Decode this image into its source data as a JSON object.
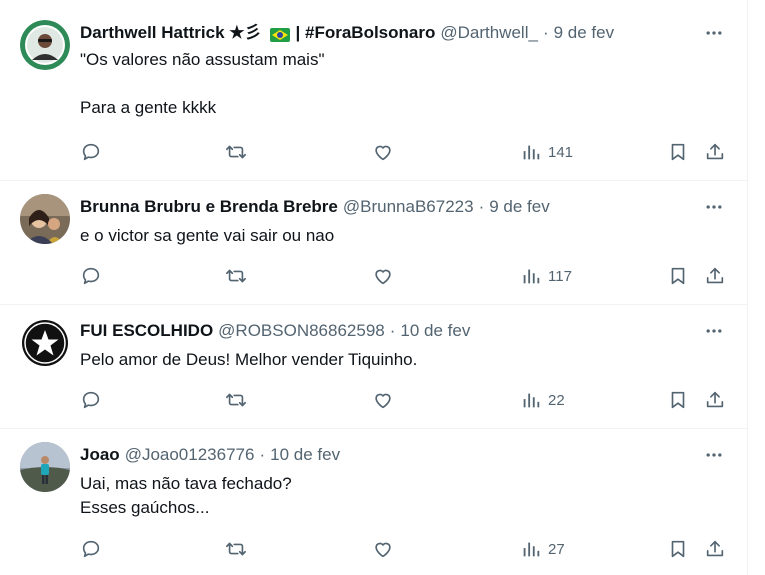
{
  "colors": {
    "text_primary": "#0f1419",
    "text_secondary": "#536471",
    "divider": "#eff3f4"
  },
  "tweets": [
    {
      "author_name": "Darthwell Hattrick ★彡",
      "author_suffix": "| #ForaBolsonaro",
      "badge_icon": "brazil-flag-icon",
      "handle": "@Darthwell_",
      "dot": "·",
      "date": "9 de fev",
      "lines": [
        "\"Os valores não assustam mais\"",
        "",
        "Para a gente kkkk"
      ],
      "views": "141",
      "avatar_icon": "avatar-green-circle-crest"
    },
    {
      "author_name": "Brunna Brubru e Brenda Brebre",
      "handle": "@BrunnaB67223",
      "dot": "·",
      "date": "9 de fev",
      "lines": [
        "e o victor sa gente vai sair ou nao"
      ],
      "views": "117",
      "avatar_icon": "avatar-photo"
    },
    {
      "author_name": "FUI ESCOLHIDO",
      "handle": "@ROBSON86862598",
      "dot": "·",
      "date": "10 de fev",
      "lines": [
        "Pelo amor de Deus! Melhor vender Tiquinho."
      ],
      "views": "22",
      "avatar_icon": "avatar-star-crest"
    },
    {
      "author_name": "Joao",
      "handle": "@Joao01236776",
      "dot": "·",
      "date": "10 de fev",
      "lines": [
        "Uai, mas não tava fechado?",
        "Esses gaúchos..."
      ],
      "views": "27",
      "avatar_icon": "avatar-landscape-photo"
    }
  ],
  "icons": {
    "reply": "reply-icon",
    "retweet": "retweet-icon",
    "like": "heart-icon",
    "views": "views-icon",
    "bookmark": "bookmark-icon",
    "share": "share-icon",
    "more": "more-icon"
  }
}
